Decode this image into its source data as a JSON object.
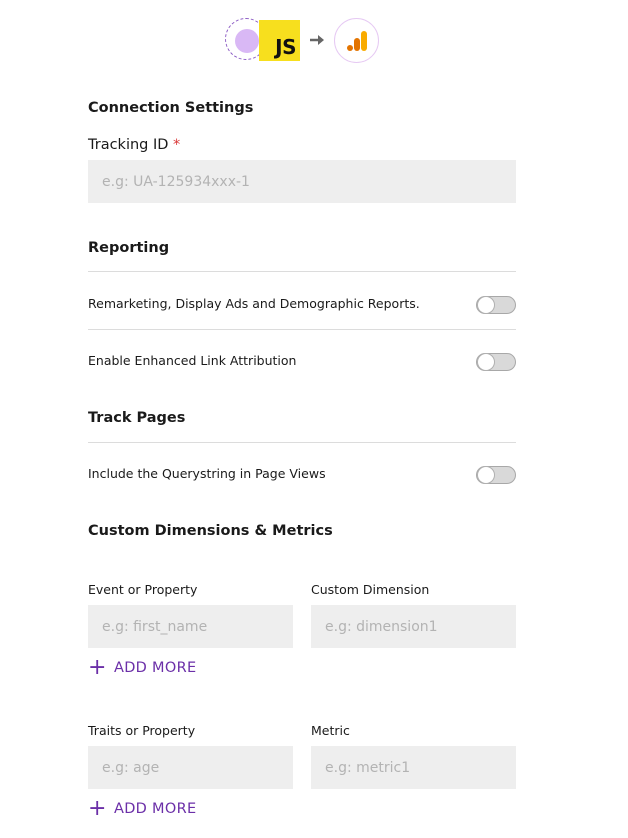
{
  "header": {
    "source_icon": "javascript-icon",
    "source_badge_text": "JS",
    "arrow_icon": "arrow-right-icon",
    "destination_icon": "google-analytics-icon"
  },
  "connection": {
    "title": "Connection Settings",
    "tracking_label": "Tracking ID",
    "required_mark": "*",
    "tracking_placeholder": "e.g: UA-125934xxx-1",
    "tracking_value": ""
  },
  "reporting": {
    "title": "Reporting",
    "remarketing_label": "Remarketing, Display Ads and Demographic Reports.",
    "remarketing_enabled": false,
    "link_attribution_label": "Enable Enhanced Link Attribution",
    "link_attribution_enabled": false
  },
  "track_pages": {
    "title": "Track Pages",
    "querystring_label": "Include the Querystring in Page Views",
    "querystring_enabled": false
  },
  "custom": {
    "title": "Custom Dimensions & Metrics",
    "dimensions": {
      "left_label": "Event or Property",
      "left_placeholder": "e.g: first_name",
      "right_label": "Custom Dimension",
      "right_placeholder": "e.g: dimension1",
      "add_more": "ADD MORE"
    },
    "metrics": {
      "left_label": "Traits or Property",
      "left_placeholder": "e.g: age",
      "right_label": "Metric",
      "right_placeholder": "e.g: metric1",
      "add_more": "ADD MORE"
    }
  },
  "colors": {
    "accent": "#6b2fa8",
    "js_yellow": "#f7df1e",
    "required_red": "#d93636",
    "input_bg": "#eeeeee"
  }
}
